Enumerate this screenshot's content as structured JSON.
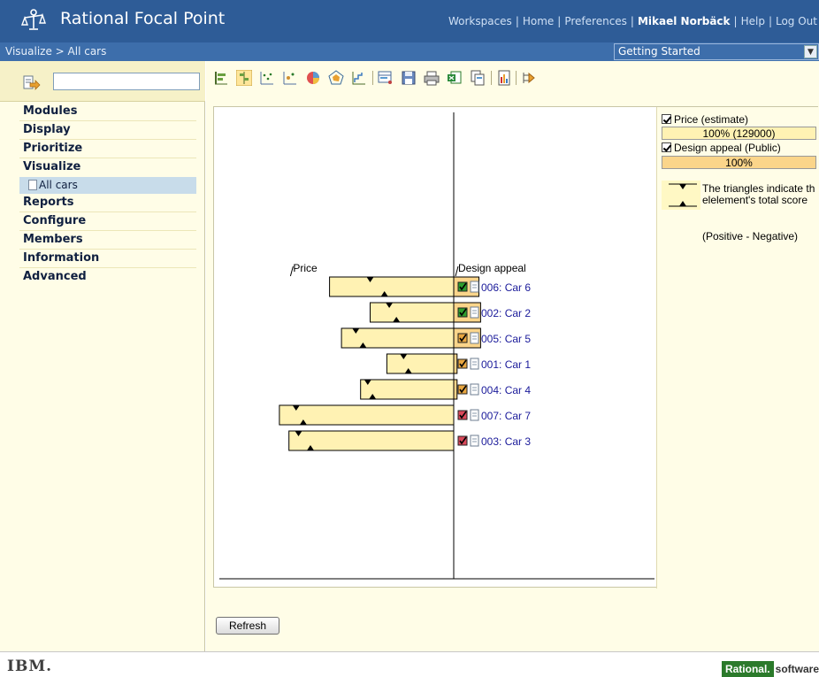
{
  "header": {
    "app_title": "Rational Focal Point",
    "nav": [
      {
        "label": "Workspaces"
      },
      {
        "label": "Home"
      },
      {
        "label": "Preferences"
      },
      {
        "label": "Mikael Norbäck"
      },
      {
        "label": "Help"
      },
      {
        "label": "Log Out"
      }
    ]
  },
  "breadcrumb": "Visualize > All cars",
  "workspace_select": {
    "value": "Getting Started"
  },
  "search": {
    "value": ""
  },
  "sidebar": {
    "items": [
      {
        "label": "Modules"
      },
      {
        "label": "Display"
      },
      {
        "label": "Prioritize"
      },
      {
        "label": "Visualize"
      },
      {
        "label": "Reports"
      },
      {
        "label": "Configure"
      },
      {
        "label": "Members"
      },
      {
        "label": "Information"
      },
      {
        "label": "Advanced"
      }
    ],
    "visualize_sub": [
      {
        "label": "All cars"
      }
    ]
  },
  "toolbar": {
    "icons": [
      "bar-chart-icon",
      "bar-chart-centered-icon",
      "scatter-chart-icon",
      "bubble-chart-icon",
      "pie-chart-icon",
      "radar-chart-icon",
      "step-chart-icon",
      "grid-options-icon",
      "save-icon",
      "print-icon",
      "export-excel-icon",
      "copy-icon",
      "report-icon",
      "settings-icon"
    ]
  },
  "chart_data": {
    "type": "bar",
    "left_axis_label": "Price",
    "right_axis_label": "Design appeal",
    "items": [
      {
        "label": "006: Car 6",
        "price": 0.52,
        "design": 0.15,
        "status": "green",
        "score_top": 0.35,
        "score_bottom": 0.29
      },
      {
        "label": "002: Car 2",
        "price": 0.35,
        "design": 0.16,
        "status": "green",
        "score_top": 0.27,
        "score_bottom": 0.24
      },
      {
        "label": "005: Car 5",
        "price": 0.47,
        "design": 0.16,
        "status": "orange",
        "score_top": 0.41,
        "score_bottom": 0.38
      },
      {
        "label": "001: Car 1",
        "price": 0.28,
        "design": 0.02,
        "status": "orange",
        "score_top": 0.21,
        "score_bottom": 0.19
      },
      {
        "label": "004: Car 4",
        "price": 0.39,
        "design": 0.02,
        "status": "orange",
        "score_top": 0.36,
        "score_bottom": 0.34
      },
      {
        "label": "007: Car 7",
        "price": 0.73,
        "design": 0.0,
        "status": "red",
        "score_top": 0.66,
        "score_bottom": 0.63
      },
      {
        "label": "003: Car 3",
        "price": 0.69,
        "design": 0.0,
        "status": "red",
        "score_top": 0.65,
        "score_bottom": 0.6
      }
    ]
  },
  "legend": {
    "series1_label": "Price (estimate)",
    "series1_value": "100% (129000)",
    "series1_color": "#fff2b3",
    "series2_label": "Design appeal (Public)",
    "series2_value": "100%",
    "series2_color": "#fbd58a",
    "note": "The triangles indicate thelelement's total score",
    "note2": "(Positive - Negative)"
  },
  "refresh_label": "Refresh",
  "footer": {
    "ibm": "IBM.",
    "rational_badge": "Rational.",
    "rational_tail": "software"
  },
  "colors": {
    "header_bg": "#2e5c97",
    "sidebar_bg": "#fffde7",
    "bar_fill": "#fff2b3",
    "design_fill": "#fbd58a",
    "status_green": "#2e9d2e",
    "status_orange": "#e8a640",
    "status_red": "#d9485a"
  }
}
